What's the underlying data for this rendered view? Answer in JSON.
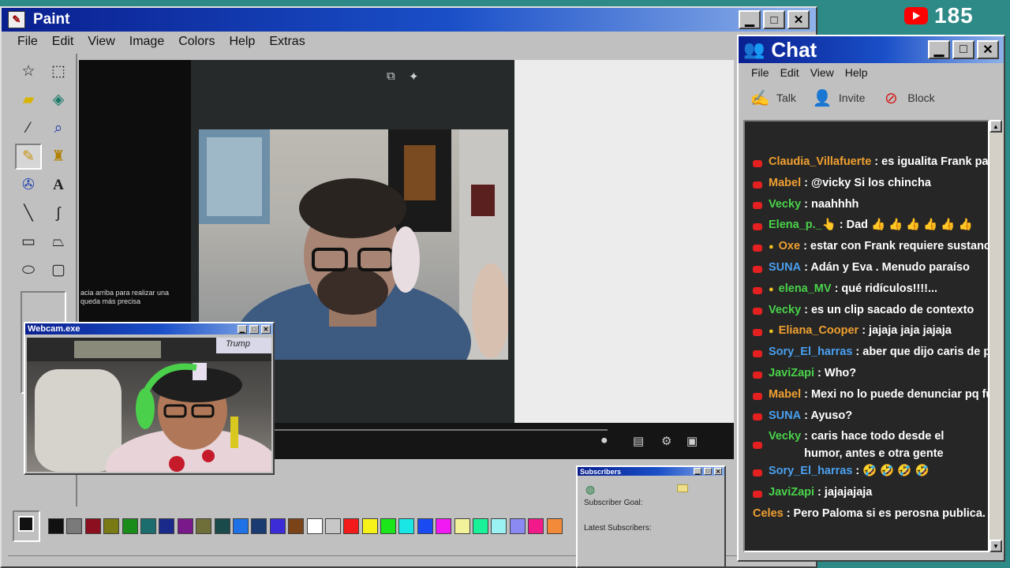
{
  "paint": {
    "title": "Paint",
    "menu": [
      "File",
      "Edit",
      "View",
      "Image",
      "Colors",
      "Help",
      "Extras"
    ],
    "tools": [
      "free-select",
      "rect-select",
      "eraser",
      "fill",
      "eyedropper",
      "magnifier",
      "pencil",
      "brush",
      "airbrush",
      "text",
      "line",
      "curve",
      "rectangle",
      "polygon",
      "ellipse",
      "rounded-rect"
    ],
    "palette": [
      "#111111",
      "#7a7a7a",
      "#8b0f1e",
      "#7a7a14",
      "#1a8c1a",
      "#1c6e6e",
      "#1a2a8a",
      "#7a1a8a",
      "#6f6f3a",
      "#1a4a4a",
      "#1e72e6",
      "#1a3a72",
      "#3c2cd8",
      "#7a4418",
      "#ffffff",
      "#c7c7c7",
      "#f21a1a",
      "#f7f21a",
      "#1ae61a",
      "#1ae6e6",
      "#1a4af2",
      "#f21af2",
      "#f2f29a",
      "#1af29a",
      "#9af2f2",
      "#8a8af2",
      "#f21a8a",
      "#f28a3a"
    ],
    "canvas_hint": "acia arriba para realizar una\nqueda más precisa"
  },
  "webcam": {
    "title": "Webcam.exe",
    "poster_text": "Trump"
  },
  "subscribers": {
    "title": "Subscribers",
    "goal_label": "Subscriber Goal:",
    "latest_label": "Latest Subscribers:"
  },
  "youtube": {
    "count": "185"
  },
  "chat": {
    "title": "Chat",
    "menu": [
      "File",
      "Edit",
      "View",
      "Help"
    ],
    "actions": [
      {
        "label": "Talk",
        "icon": "talk-icon"
      },
      {
        "label": "Invite",
        "icon": "invite-icon"
      },
      {
        "label": "Block",
        "icon": "block-icon"
      }
    ],
    "messages": [
      {
        "user": "Claudia_Villafuerte",
        "color": "#f0a030",
        "text": ": es igualita Frank par d enfe",
        "bulb": false,
        "yt": true
      },
      {
        "user": "Mabel",
        "color": "#f0a030",
        "text": ": @vicky Si los chincha",
        "bulb": false,
        "yt": true
      },
      {
        "user": "Vecky",
        "color": "#49d24a",
        "text": ": naahhhh",
        "bulb": false,
        "yt": true
      },
      {
        "user": "Elena_p._👆",
        "color": "#49d24a",
        "text": ": Dad 👍 👍 👍 👍 👍 👍",
        "bulb": false,
        "yt": true
      },
      {
        "user": "Oxe",
        "color": "#f0a030",
        "text": ": estar con Frank requiere sustancias má",
        "bulb": true,
        "yt": true
      },
      {
        "user": "SUNA",
        "color": "#4aa0f0",
        "text": ": Adán y Eva . Menudo paraíso",
        "bulb": false,
        "yt": true
      },
      {
        "user": "elena_MV",
        "color": "#49d24a",
        "text": ": qué ridículos!!!!...",
        "bulb": true,
        "yt": true
      },
      {
        "user": "Vecky",
        "color": "#49d24a",
        "text": ": es un clip sacado de contexto",
        "bulb": false,
        "yt": true
      },
      {
        "user": "Eliana_Cooper",
        "color": "#f0a030",
        "text": ": jajaja jaja jajaja",
        "bulb": true,
        "yt": true
      },
      {
        "user": "Sory_El_harras",
        "color": "#4aa0f0",
        "text": ": aber que dijo caris de paloma",
        "bulb": false,
        "yt": true
      },
      {
        "user": "JaviZapi",
        "color": "#49d24a",
        "text": ": Who?",
        "bulb": false,
        "yt": true
      },
      {
        "user": "Mabel",
        "color": "#f0a030",
        "text": ": Mexi no lo puede denunciar pq fue Fran",
        "bulb": false,
        "yt": true
      },
      {
        "user": "SUNA",
        "color": "#4aa0f0",
        "text": ": Ayuso?",
        "bulb": false,
        "yt": true
      },
      {
        "user": "Vecky",
        "color": "#49d24a",
        "text": ": caris hace todo desde el humor, antes e otra gente",
        "bulb": false,
        "yt": true,
        "wrap": true
      },
      {
        "user": "Sory_El_harras",
        "color": "#4aa0f0",
        "text": ": 🤣 🤣 🤣 🤣",
        "bulb": false,
        "yt": true
      },
      {
        "user": "JaviZapi",
        "color": "#49d24a",
        "text": ": jajajajaja",
        "bulb": false,
        "yt": true
      },
      {
        "user": "Celes",
        "color": "#f0a030",
        "text": ": Pero Paloma si es perosna publica. la cone",
        "bulb": false,
        "yt": false
      }
    ]
  }
}
